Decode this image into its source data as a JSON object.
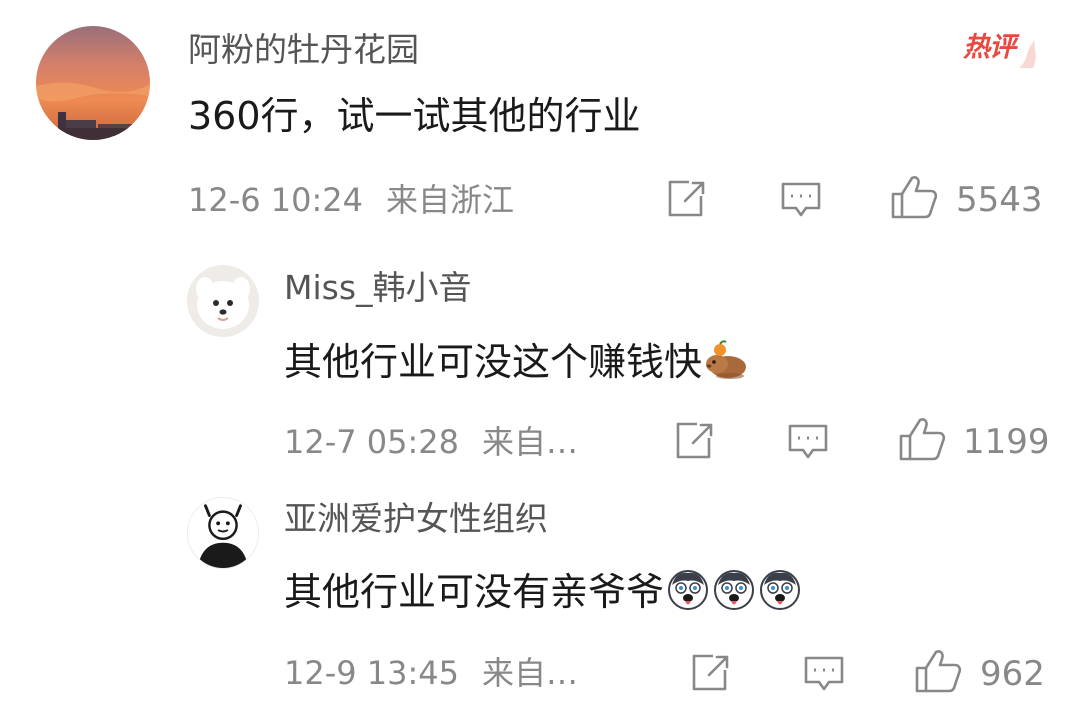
{
  "badge": {
    "label": "热评",
    "color": "#e8483f"
  },
  "comment": {
    "user": "阿粉的牡丹花园",
    "text": "360行，试一试其他的行业",
    "time": "12-6 10:24",
    "location": "来自浙江",
    "likes": "5543"
  },
  "replies": [
    {
      "user": "Miss_韩小音",
      "text": "其他行业可没这个赚钱快",
      "emoji": "capybara-with-orange-emoji",
      "time": "12-7 05:28",
      "location": "来自…",
      "likes": "1199"
    },
    {
      "user": "亚洲爱护女性组织",
      "text": "其他行业可没有亲爷爷",
      "emoji": "husky-dog-emoji",
      "time": "12-9 13:45",
      "location": "来自…",
      "likes": "962"
    }
  ],
  "icons": {
    "share": "share-icon",
    "reply": "comment-icon",
    "like": "thumbs-up-icon"
  },
  "colors": {
    "text": "#1a1a1a",
    "username": "#555555",
    "meta": "#888888",
    "icon": "#888888"
  }
}
